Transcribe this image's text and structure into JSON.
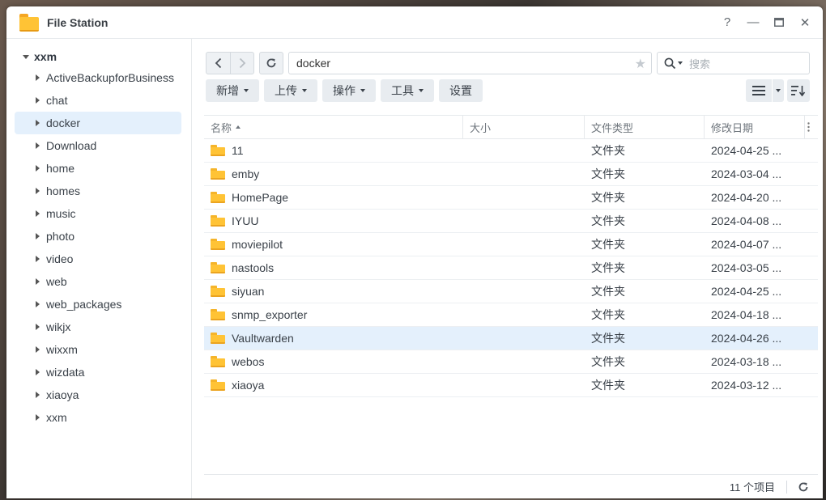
{
  "window": {
    "title": "File Station",
    "help": "?",
    "minimize": "—",
    "maximize": "▭",
    "close": "✕"
  },
  "sidebar": {
    "root": "xxm",
    "items": [
      {
        "label": "ActiveBackupforBusiness"
      },
      {
        "label": "chat"
      },
      {
        "label": "docker"
      },
      {
        "label": "Download"
      },
      {
        "label": "home"
      },
      {
        "label": "homes"
      },
      {
        "label": "music"
      },
      {
        "label": "photo"
      },
      {
        "label": "video"
      },
      {
        "label": "web"
      },
      {
        "label": "web_packages"
      },
      {
        "label": "wikjx"
      },
      {
        "label": "wixxm"
      },
      {
        "label": "wizdata"
      },
      {
        "label": "xiaoya"
      },
      {
        "label": "xxm"
      }
    ],
    "selected_index": 2
  },
  "nav": {
    "path": "docker",
    "search_placeholder": "搜索"
  },
  "toolbar": {
    "create": "新增",
    "upload": "上传",
    "action": "操作",
    "tools": "工具",
    "settings": "设置"
  },
  "grid": {
    "headers": {
      "name": "名称",
      "size": "大小",
      "type": "文件类型",
      "modified": "修改日期"
    },
    "rows": [
      {
        "name": "11",
        "size": "",
        "type": "文件夹",
        "modified": "2024-04-25 ..."
      },
      {
        "name": "emby",
        "size": "",
        "type": "文件夹",
        "modified": "2024-03-04 ..."
      },
      {
        "name": "HomePage",
        "size": "",
        "type": "文件夹",
        "modified": "2024-04-20 ..."
      },
      {
        "name": "IYUU",
        "size": "",
        "type": "文件夹",
        "modified": "2024-04-08 ..."
      },
      {
        "name": "moviepilot",
        "size": "",
        "type": "文件夹",
        "modified": "2024-04-07 ..."
      },
      {
        "name": "nastools",
        "size": "",
        "type": "文件夹",
        "modified": "2024-03-05 ..."
      },
      {
        "name": "siyuan",
        "size": "",
        "type": "文件夹",
        "modified": "2024-04-25 ..."
      },
      {
        "name": "snmp_exporter",
        "size": "",
        "type": "文件夹",
        "modified": "2024-04-18 ..."
      },
      {
        "name": "Vaultwarden",
        "size": "",
        "type": "文件夹",
        "modified": "2024-04-26 ..."
      },
      {
        "name": "webos",
        "size": "",
        "type": "文件夹",
        "modified": "2024-03-18 ..."
      },
      {
        "name": "xiaoya",
        "size": "",
        "type": "文件夹",
        "modified": "2024-03-12 ..."
      }
    ],
    "selected_index": 8
  },
  "footer": {
    "count": "11 个项目"
  },
  "icons": {
    "app": "folder-icon",
    "back": "chevron-left-icon",
    "forward": "chevron-right-icon",
    "refresh": "refresh-icon",
    "favorite": "star-icon",
    "search": "search-icon",
    "list_view": "list-view-icon",
    "sort": "sort-icon"
  }
}
